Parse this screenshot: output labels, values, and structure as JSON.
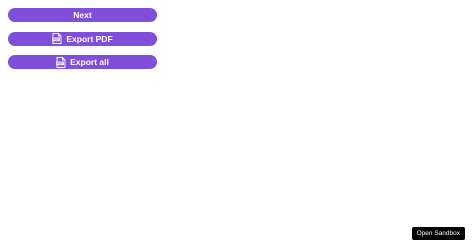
{
  "buttons": {
    "next_label": "Next",
    "export_pdf_label": "Export PDF",
    "export_all_label": "Export all"
  },
  "icons": {
    "export_pdf_icon": "pdf-file-icon",
    "export_all_icon": "pdf-file-icon"
  },
  "sandbox": {
    "label": "Open Sandbox"
  },
  "colors": {
    "button_bg": "#7f4fd9",
    "button_text": "#ffffff",
    "sandbox_bg": "#000000"
  }
}
